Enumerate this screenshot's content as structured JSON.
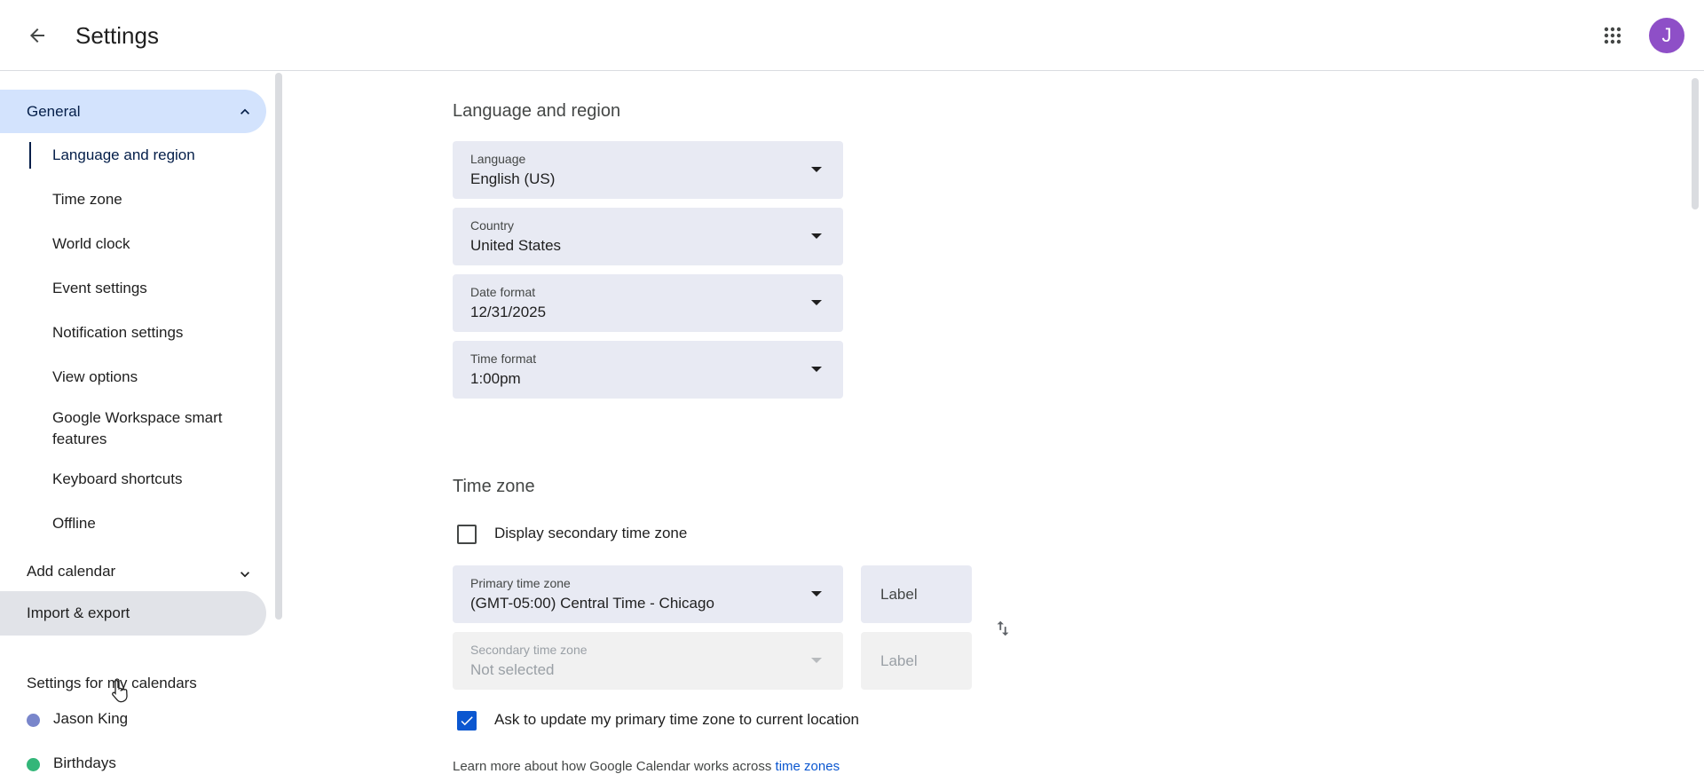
{
  "header": {
    "title": "Settings",
    "avatar_initial": "J"
  },
  "sidebar": {
    "general_label": "General",
    "sub_items": [
      "Language and region",
      "Time zone",
      "World clock",
      "Event settings",
      "Notification settings",
      "View options",
      "Google Workspace smart features",
      "Keyboard shortcuts",
      "Offline"
    ],
    "add_calendar_label": "Add calendar",
    "import_export_label": "Import & export",
    "my_calendars_heading": "Settings for my calendars",
    "calendars": [
      {
        "name": "Jason King",
        "color": "#7986cb"
      },
      {
        "name": "Birthdays",
        "color": "#33b679"
      }
    ]
  },
  "language_region": {
    "heading": "Language and region",
    "fields": [
      {
        "label": "Language",
        "value": "English (US)"
      },
      {
        "label": "Country",
        "value": "United States"
      },
      {
        "label": "Date format",
        "value": "12/31/2025"
      },
      {
        "label": "Time format",
        "value": "1:00pm"
      }
    ]
  },
  "time_zone": {
    "heading": "Time zone",
    "display_secondary_label": "Display secondary time zone",
    "display_secondary_checked": false,
    "primary": {
      "label": "Primary time zone",
      "value": "(GMT-05:00) Central Time - Chicago",
      "label_placeholder": "Label"
    },
    "secondary": {
      "label": "Secondary time zone",
      "value": "Not selected",
      "label_placeholder": "Label"
    },
    "ask_update_label": "Ask to update my primary time zone to current location",
    "ask_update_checked": true,
    "learn_more_text": "Learn more about how Google Calendar works across ",
    "learn_more_link": "time zones"
  },
  "colors": {
    "accent": "#0b57d0",
    "nav_active_bg": "#d3e3fd",
    "field_bg": "#e8eaf3",
    "avatar_bg": "#8e4fc7"
  }
}
